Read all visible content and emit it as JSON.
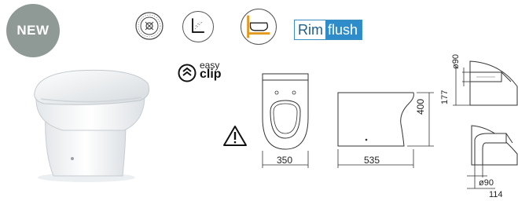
{
  "badge": {
    "label": "NEW",
    "color": "#8f9a97"
  },
  "features": {
    "icons": [
      "certified-seal-icon",
      "wall-mounted-angle-icon",
      "back-to-wall-toilet-icon"
    ],
    "rimflush": {
      "rim": "Rim",
      "flush": "flush",
      "accent": "#2d8cc9"
    }
  },
  "easy_clip": {
    "line1": "easy",
    "line2": "clip"
  },
  "dimensions": {
    "width": "350",
    "depth": "535",
    "height": "400",
    "outlet_diameter_top": "ø90",
    "outlet_height": "177",
    "outlet_diameter_bottom": "ø90",
    "outlet_offset": "114"
  }
}
